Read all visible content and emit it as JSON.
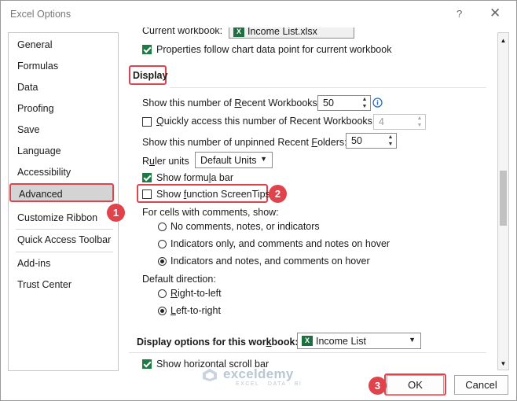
{
  "window": {
    "title": "Excel Options",
    "help_glyph": "?",
    "close_glyph": "✕"
  },
  "sidebar": {
    "items": [
      {
        "label": "General"
      },
      {
        "label": "Formulas"
      },
      {
        "label": "Data"
      },
      {
        "label": "Proofing"
      },
      {
        "label": "Save"
      },
      {
        "label": "Language"
      },
      {
        "label": "Accessibility"
      },
      {
        "label": "Advanced",
        "selected": true
      },
      {
        "label": "Customize Ribbon"
      },
      {
        "label": "Quick Access Toolbar"
      },
      {
        "label": "Add-ins"
      },
      {
        "label": "Trust Center"
      }
    ]
  },
  "content": {
    "current_workbook_label": "Current workbook:",
    "current_workbook_value": "Income List.xlsx",
    "properties_follow_label": "Properties follow chart data point for current workbook",
    "properties_follow_checked": true,
    "display_header": "Display",
    "recent_workbooks_label": "Show this number of Recent Workbooks:",
    "recent_workbooks_value": "50",
    "quick_access_label": "Quickly access this number of Recent Workbooks:",
    "quick_access_checked": false,
    "quick_access_value": "4",
    "unpinned_folders_label": "Show this number of unpinned Recent Folders:",
    "unpinned_folders_value": "50",
    "ruler_units_label": "Ruler units",
    "ruler_units_value": "Default Units",
    "formula_bar_label": "Show formula bar",
    "formula_bar_checked": true,
    "screentips_label": "Show function ScreenTips",
    "screentips_checked": false,
    "comments_label": "For cells with comments, show:",
    "comments_options": [
      {
        "label": "No comments, notes, or indicators",
        "selected": false
      },
      {
        "label": "Indicators only, and comments and notes on hover",
        "selected": false
      },
      {
        "label": "Indicators and notes, and comments on hover",
        "selected": true
      }
    ],
    "direction_label": "Default direction:",
    "direction_options": [
      {
        "label": "Right-to-left",
        "selected": false
      },
      {
        "label": "Left-to-right",
        "selected": true
      }
    ],
    "workbook_display_header": "Display options for this workbook:",
    "workbook_display_value": "Income List",
    "horizontal_scroll_label": "Show horizontal scroll bar",
    "horizontal_scroll_checked": true
  },
  "icons": {
    "info_glyph": "i",
    "excel_glyph": "X",
    "spin_up": "▲",
    "spin_down": "▼",
    "caret": "▼"
  },
  "annotations": {
    "step1": "1",
    "step2": "2",
    "step3": "3"
  },
  "buttons": {
    "ok": "OK",
    "cancel": "Cancel"
  },
  "watermark": {
    "name": "exceldemy",
    "tagline": "EXCEL · DATA · BI"
  },
  "colors": {
    "highlight": "#e0434b",
    "checkbox_checked": "#1e7b45",
    "selected_nav": "#d4d4d4",
    "info_icon": "#1f6fd0",
    "excel_green": "#1d6f42"
  }
}
